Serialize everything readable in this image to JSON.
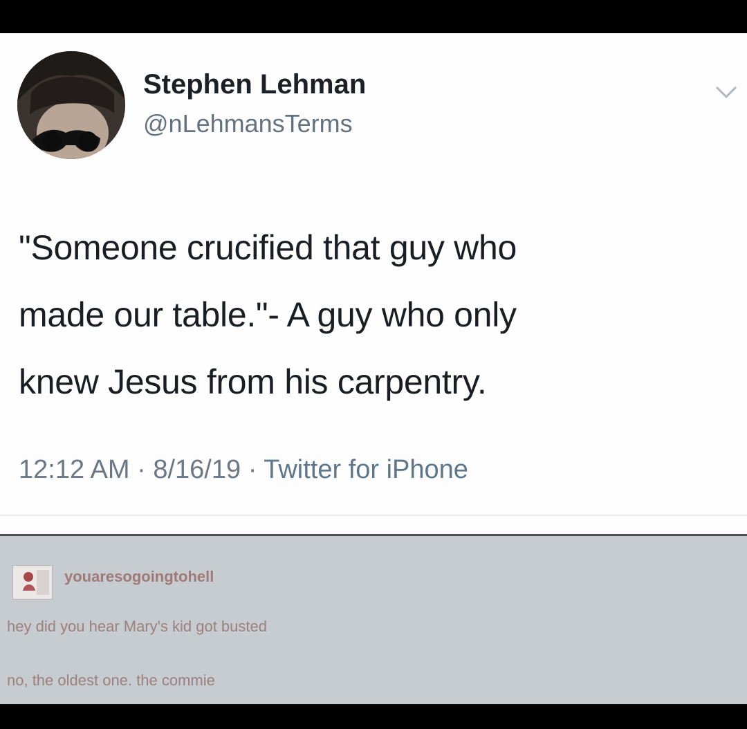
{
  "tweet": {
    "display_name": "Stephen Lehman",
    "handle": "@nLehmansTerms",
    "text_lines": [
      "\"Someone crucified that guy who",
      "made our table.\"- A guy who only",
      "knew Jesus from his carpentry."
    ],
    "time": "12:12 AM",
    "date": "8/16/19",
    "source": "Twitter for iPhone",
    "separator": "·",
    "menu_icon": "chevron-down-icon",
    "avatar_icon": "avatar-sunglasses-photo"
  },
  "tumblr": {
    "username": "youaresogoingtohell",
    "avatar_icon": "user-avatar-icon",
    "lines": [
      "hey did you hear Mary's kid got busted",
      "no, the oldest one. the commie"
    ]
  },
  "colors": {
    "tweet_background": "#fdfdfd",
    "text_primary": "#1a1d21",
    "text_secondary": "#64717e",
    "tumblr_background": "#c7ccd0",
    "tumblr_text": "#9c7f7f"
  }
}
